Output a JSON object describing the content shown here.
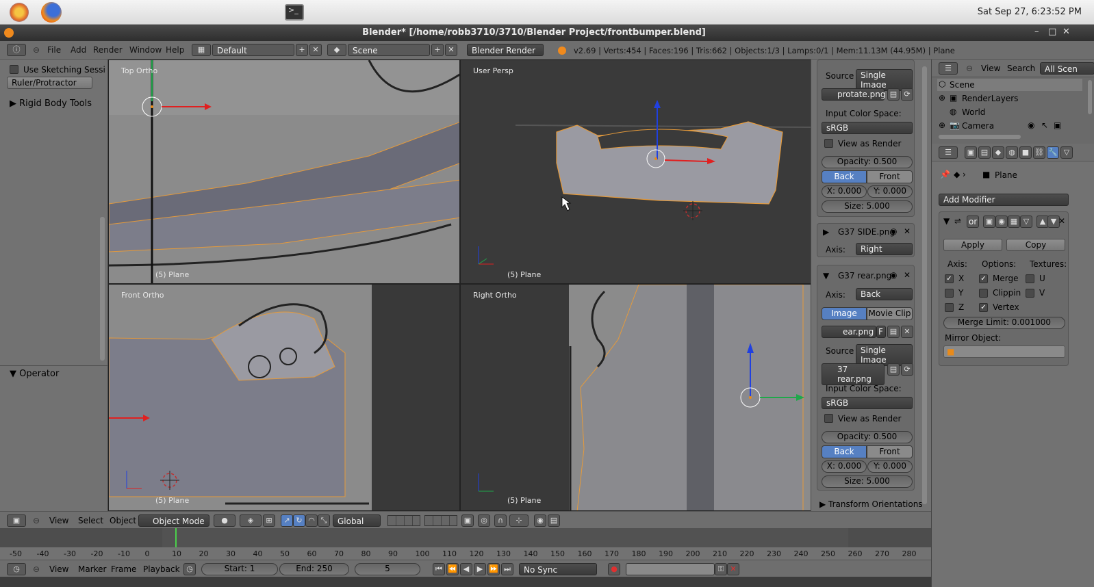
{
  "system": {
    "clock": "Sat Sep 27,  6:23:52 PM"
  },
  "window": {
    "title": "Blender* [/home/robb3710/3710/Blender Project/frontbumper.blend]",
    "minimize": "–",
    "maximize": "□",
    "close": "✕"
  },
  "header": {
    "menus": [
      "File",
      "Add",
      "Render",
      "Window",
      "Help"
    ],
    "layout": "Default",
    "scene": "Scene",
    "engine": "Blender Render",
    "stats": "v2.69 | Verts:454 | Faces:196 | Tris:662 | Objects:1/3 | Lamps:0/1 | Mem:11.13M (44.95M) | Plane"
  },
  "tools": {
    "sketching": "Use Sketching Sessi",
    "ruler": "Ruler/Protractor",
    "rigid": "Rigid Body Tools",
    "operator": "Operator"
  },
  "viewports": {
    "tl": {
      "label": "Top Ortho",
      "name": "(5) Plane"
    },
    "tr": {
      "label": "User Persp",
      "name": "(5) Plane"
    },
    "bl": {
      "label": "Front Ortho",
      "name": "(5) Plane"
    },
    "br": {
      "label": "Right Ortho",
      "name": "(5) Plane"
    }
  },
  "bgpanel": {
    "source_label": "Source",
    "source_value": "Single Image",
    "file1": "protate.png",
    "ics_label": "Input Color Space:",
    "ics_value": "sRGB",
    "view_as_render": "View as Render",
    "opacity": "Opacity: 0.500",
    "back": "Back",
    "front": "Front",
    "x": "X: 0.000",
    "y": "Y: 0.000",
    "size": "Size: 5.000",
    "side_name": "G37 SIDE.png",
    "axis_label": "Axis:",
    "axis_side": "Right",
    "rear_name": "G37 rear.png",
    "axis_rear": "Back",
    "image_tab": "Image",
    "movieclip_tab": "Movie Clip",
    "rear_img": "ear.png",
    "rear_f": "F",
    "rear_file": "37 rear.png",
    "source2": "Single Image",
    "ics2": "sRGB",
    "var2": "View as Render",
    "opacity2": "Opacity: 0.500",
    "back2": "Back",
    "front2": "Front",
    "x2": "X: 0.000",
    "y2": "Y: 0.000",
    "size2": "Size: 5.000",
    "transform_orient": "Transform Orientations"
  },
  "outliner": {
    "menus": [
      "View",
      "Search"
    ],
    "filter": "All Scen",
    "items": [
      "Scene",
      "RenderLayers",
      "World",
      "Camera"
    ]
  },
  "props": {
    "object": "Plane",
    "add_modifier": "Add Modifier",
    "mod_name": "or",
    "apply": "Apply",
    "copy": "Copy",
    "axis": "Axis:",
    "options": "Options:",
    "textures": "Textures:",
    "x": "X",
    "y": "Y",
    "z": "Z",
    "merge": "Merge",
    "clipping": "Clippin",
    "vertex": "Vertex",
    "u": "U",
    "v": "V",
    "merge_limit": "Merge Limit: 0.001000",
    "mirror_object": "Mirror Object:"
  },
  "vpbar": {
    "menus": [
      "View",
      "Select",
      "Object"
    ],
    "mode": "Object Mode",
    "orient": "Global"
  },
  "timeline": {
    "ticks": [
      "-50",
      "-40",
      "-30",
      "-20",
      "-10",
      "0",
      "10",
      "20",
      "30",
      "40",
      "50",
      "60",
      "70",
      "80",
      "90",
      "100",
      "110",
      "120",
      "130",
      "140",
      "150",
      "160",
      "170",
      "180",
      "190",
      "200",
      "210",
      "220",
      "230",
      "240",
      "250",
      "260",
      "270",
      "280"
    ]
  },
  "tlbar": {
    "menus": [
      "View",
      "Marker",
      "Frame",
      "Playback"
    ],
    "start": "Start: 1",
    "end": "End: 250",
    "frame": "5",
    "sync": "No Sync"
  }
}
